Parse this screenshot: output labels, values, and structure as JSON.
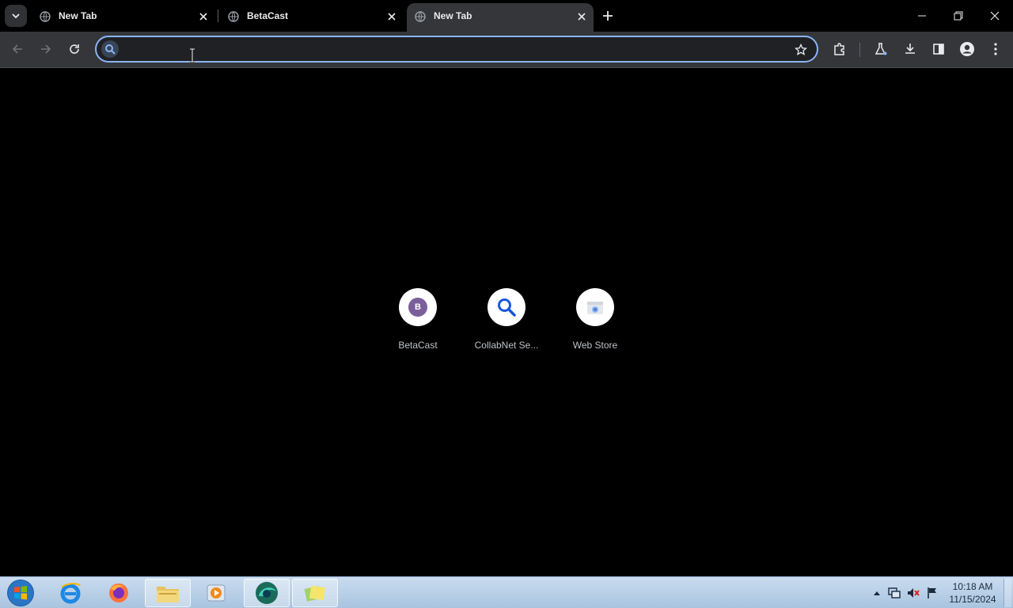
{
  "tabs": [
    {
      "title": "New Tab",
      "favicon": "globe-icon",
      "active": false
    },
    {
      "title": "BetaCast",
      "favicon": "globe-icon",
      "active": false
    },
    {
      "title": "New Tab",
      "favicon": "globe-icon",
      "active": true
    }
  ],
  "omnibox": {
    "value": "",
    "placeholder": ""
  },
  "shortcuts": [
    {
      "label": "BetaCast",
      "icon": "letter-avatar",
      "letter": "B"
    },
    {
      "label": "CollabNet Se...",
      "icon": "search-icon"
    },
    {
      "label": "Web Store",
      "icon": "webstore-icon"
    }
  ],
  "taskbar": {
    "apps": [
      "start-orb",
      "internet-explorer",
      "firefox",
      "file-explorer",
      "media-player",
      "browser",
      "sticky-notes"
    ],
    "clock_time": "10:18 AM",
    "clock_date": "11/15/2024"
  },
  "colors": {
    "accent": "#8ab4f8",
    "toolbar": "#35363a",
    "omnibox": "#202124",
    "page": "#000000"
  }
}
